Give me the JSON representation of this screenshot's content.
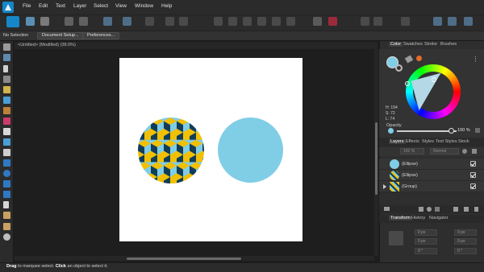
{
  "menubar": {
    "items": [
      "File",
      "Edit",
      "Text",
      "Layer",
      "Select",
      "View",
      "Window",
      "Help"
    ]
  },
  "context": {
    "selection_label": "No Selection",
    "document_setup_button": "Document Setup...",
    "preferences_button": "Preferences..."
  },
  "document": {
    "title": "<Untitled> (Modified) (38.0%)"
  },
  "color_panel": {
    "tabs": [
      "Color",
      "Swatches",
      "Stroke",
      "Brushes"
    ],
    "active_tab": "Color",
    "h": "H: 194",
    "s": "S: 72",
    "l": "L: 74",
    "opacity_label": "Opacity",
    "opacity_value": "100 %",
    "fill_color": "#80cde6"
  },
  "layers_panel": {
    "tabs": [
      "Layers",
      "Effects",
      "Styles",
      "Text Styles",
      "Stock"
    ],
    "active_tab": "Layers",
    "opacity_value": "100 %",
    "blend_mode": "Normal",
    "layers": [
      {
        "name": "(Ellipse)",
        "thumb": "plain-ellipse"
      },
      {
        "name": "(Ellipse)",
        "thumb": "pattern-ellipse"
      },
      {
        "name": "(Group)",
        "thumb": "group"
      }
    ]
  },
  "transform_panel": {
    "tabs": [
      "Transform",
      "History",
      "Navigator"
    ],
    "active_tab": "Transform",
    "fields": [
      "0 px",
      "0 px",
      "0 px",
      "0 px",
      "0 °",
      "0 °"
    ]
  },
  "status": {
    "text_bold_1": "Drag",
    "text_1": " to marquee select. ",
    "text_bold_2": "Click",
    "text_2": " an object to select it."
  },
  "colors": {
    "accent": "#1587c8",
    "pattern_navy": "#123d57",
    "pattern_yellow": "#f2c000",
    "pattern_light": "#80cde6"
  }
}
